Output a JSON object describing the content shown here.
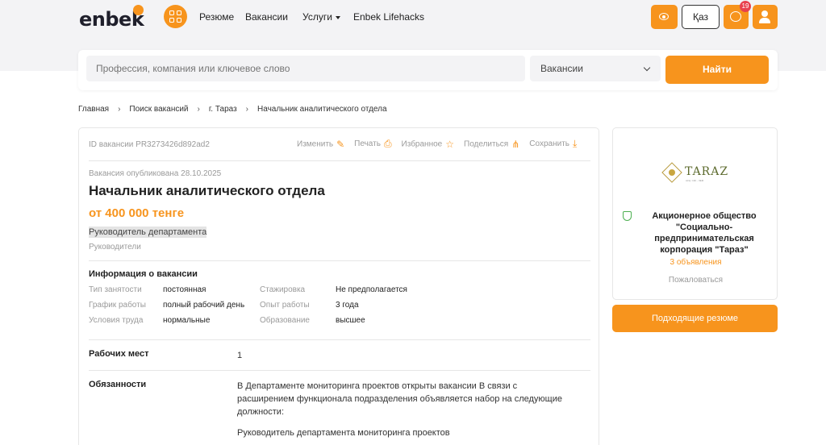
{
  "header": {
    "logo_text": "enbek",
    "nav": [
      "Резюме",
      "Вакансии",
      "Услуги",
      "Enbek Lifehacks"
    ],
    "lang_label": "Қаз",
    "notification_count": "19"
  },
  "search": {
    "placeholder": "Профессия, компания или ключевое слово",
    "category": "Вакансии",
    "button_label": "Найти"
  },
  "breadcrumb": [
    "Главная",
    "Поиск вакансий",
    "г. Тараз",
    "Начальник аналитического отдела"
  ],
  "vacancy": {
    "id_label": "ID вакансии PR3273426d892ad2",
    "actions": [
      {
        "label": "Изменить",
        "icon": "edit-icon",
        "glyph": "✎"
      },
      {
        "label": "Печать",
        "icon": "print-icon",
        "glyph": "⎙"
      },
      {
        "label": "Избранное",
        "icon": "star-icon",
        "glyph": "☆"
      },
      {
        "label": "Поделиться",
        "icon": "share-icon",
        "glyph": "⋔"
      },
      {
        "label": "Сохранить",
        "icon": "download-icon",
        "glyph": "⤓"
      }
    ],
    "published": "Вакансия опубликована 28.10.2025",
    "title": "Начальник аналитического отдела",
    "salary": "от 400 000 тенге",
    "position": "Руководитель департамента",
    "category": "Руководители",
    "info_title": "Информация о вакансии",
    "info": [
      {
        "label": "Тип занятости",
        "value": "постоянная"
      },
      {
        "label": "Стажировка",
        "value": "Не предполагается"
      },
      {
        "label": "График работы",
        "value": "полный рабочий день"
      },
      {
        "label": "Опыт работы",
        "value": "3 года"
      },
      {
        "label": "Условия труда",
        "value": "нормальные"
      },
      {
        "label": "Образование",
        "value": "высшее"
      }
    ],
    "workplaces_label": "Рабочих мест",
    "workplaces_value": "1",
    "duties_label": "Обязанности",
    "duties_text": "В Департаменте мониторинга проектов открыты вакансии В связи с расширением функционала подразделения объявляется набор на следующие должности:",
    "duties_item": "Руководитель департамента мониторинга проектов"
  },
  "company": {
    "logo_text": "TARAZ",
    "logo_sub": "АКЦ. СКК - ЗЕМ",
    "name": "Акционерное общество \"Социально-предпринимательская корпорация \"Тараз\"",
    "ads_count": "3 объявления",
    "complain": "Пожаловаться"
  },
  "resume_button": "Подходящие резюме",
  "colors": {
    "accent": "#f7941d",
    "badge": "#e8414e",
    "verified": "#4caf50"
  }
}
